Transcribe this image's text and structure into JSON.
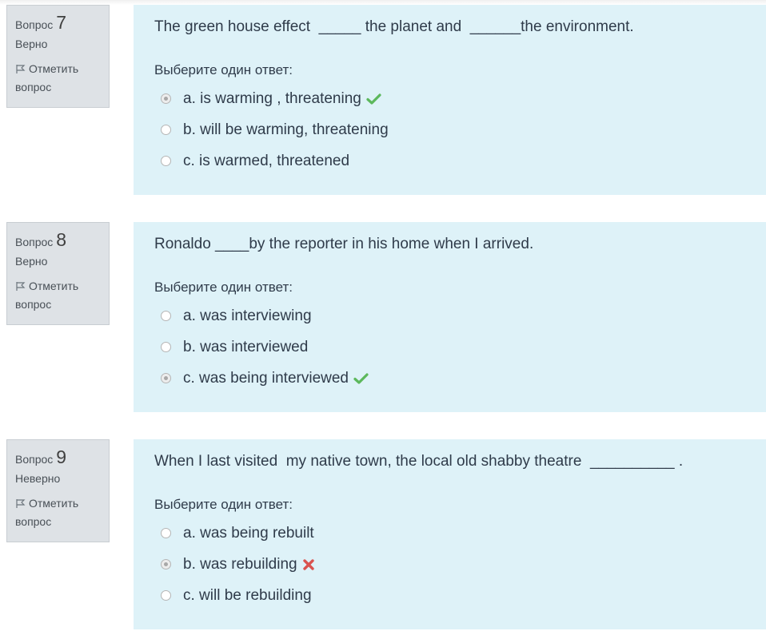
{
  "colors": {
    "info_bg": "#dee2e6",
    "content_bg": "#def2f8",
    "correct": "#5cb85c",
    "incorrect": "#d9534f"
  },
  "questions": [
    {
      "label": "Вопрос",
      "number": "7",
      "state": "Верно",
      "flag_label": "Отметить вопрос",
      "text": "The green house effect  _____ the planet and  ______the environment.",
      "prompt": "Выберите один ответ:",
      "answers": [
        {
          "text": "a. is warming , threatening",
          "selected": true,
          "mark": "check-icon"
        },
        {
          "text": "b. will be warming, threatening",
          "selected": false,
          "mark": ""
        },
        {
          "text": "c. is warmed, threatened",
          "selected": false,
          "mark": ""
        }
      ]
    },
    {
      "label": "Вопрос",
      "number": "8",
      "state": "Верно",
      "flag_label": "Отметить вопрос",
      "text": "Ronaldo ____by the reporter in his home when I arrived.",
      "prompt": "Выберите один ответ:",
      "answers": [
        {
          "text": "a. was interviewing",
          "selected": false,
          "mark": ""
        },
        {
          "text": "b. was interviewed",
          "selected": false,
          "mark": ""
        },
        {
          "text": "c. was being interviewed",
          "selected": true,
          "mark": "check-icon"
        }
      ]
    },
    {
      "label": "Вопрос",
      "number": "9",
      "state": "Неверно",
      "flag_label": "Отметить вопрос",
      "text": "When I last visited  my native town, the local old shabby theatre  __________ .",
      "prompt": "Выберите один ответ:",
      "answers": [
        {
          "text": "a. was being rebuilt",
          "selected": false,
          "mark": ""
        },
        {
          "text": "b. was rebuilding",
          "selected": true,
          "mark": "cross-icon"
        },
        {
          "text": "c. will be rebuilding",
          "selected": false,
          "mark": ""
        }
      ]
    }
  ]
}
